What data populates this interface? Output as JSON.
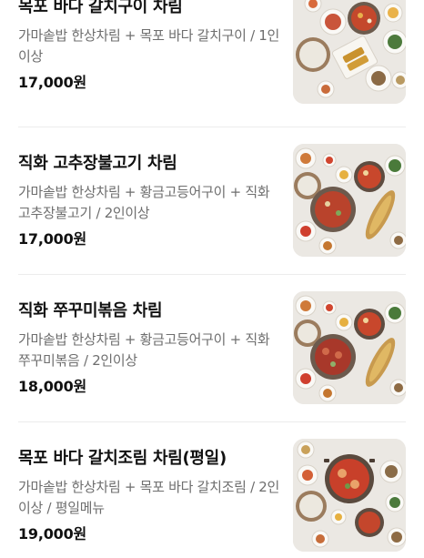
{
  "menu_items": [
    {
      "name": "목포 바다 갈치구이 차림",
      "desc": "가마솥밥 한상차림 + 목포 바다 갈치구이 / 1인이상",
      "price": "17,000원",
      "image": "table-spread-photo"
    },
    {
      "name": "직화 고추장불고기 차림",
      "desc": "가마솥밥 한상차림 + 황금고등어구이 + 직화 고추장불고기 / 2인이상",
      "price": "17,000원",
      "image": "table-spread-photo"
    },
    {
      "name": "직화 쭈꾸미볶음 차림",
      "desc": "가마솥밥 한상차림 + 황금고등어구이 + 직화 쭈꾸미볶음 / 2인이상",
      "price": "18,000원",
      "image": "table-spread-photo"
    },
    {
      "name": "목포 바다 갈치조림 차림(평일)",
      "desc": "가마솥밥 한상차림 + 목포 바다 갈치조림 / 2인이상 / 평일메뉴",
      "price": "19,000원",
      "image": "table-spread-photo"
    }
  ]
}
